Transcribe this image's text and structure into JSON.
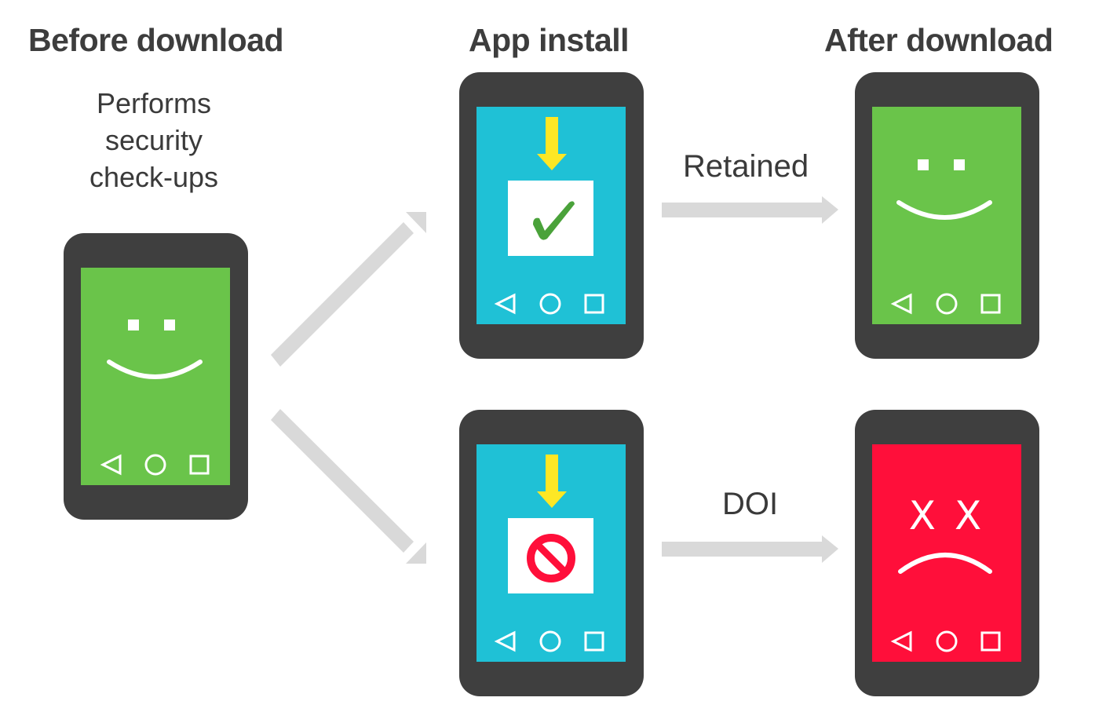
{
  "columns": {
    "before": {
      "heading": "Before download",
      "description": [
        "Performs",
        "security",
        "check-ups"
      ]
    },
    "install": {
      "heading": "App install"
    },
    "after": {
      "heading": "After download"
    }
  },
  "transitions": {
    "retained": {
      "label": "Retained"
    },
    "doi": {
      "label": "DOI"
    }
  },
  "phones": [
    {
      "id": "before",
      "screen": "happy-face",
      "screen_color": "#6ac44a"
    },
    {
      "id": "install-approved",
      "screen": "download-check",
      "screen_color": "#1fc1d6"
    },
    {
      "id": "install-blocked",
      "screen": "download-blocked",
      "screen_color": "#1fc1d6"
    },
    {
      "id": "after-retained",
      "screen": "happy-face",
      "screen_color": "#6ac44a"
    },
    {
      "id": "after-doi",
      "screen": "sad-face",
      "screen_color": "#ff0f3a",
      "eyes_text": "X X"
    }
  ],
  "colors": {
    "phone_body": "#3f3f3f",
    "arrow": "#d9d9d9",
    "download_arrow": "#fde725",
    "check": "#4aa23a",
    "block": "#ff0f3a"
  }
}
